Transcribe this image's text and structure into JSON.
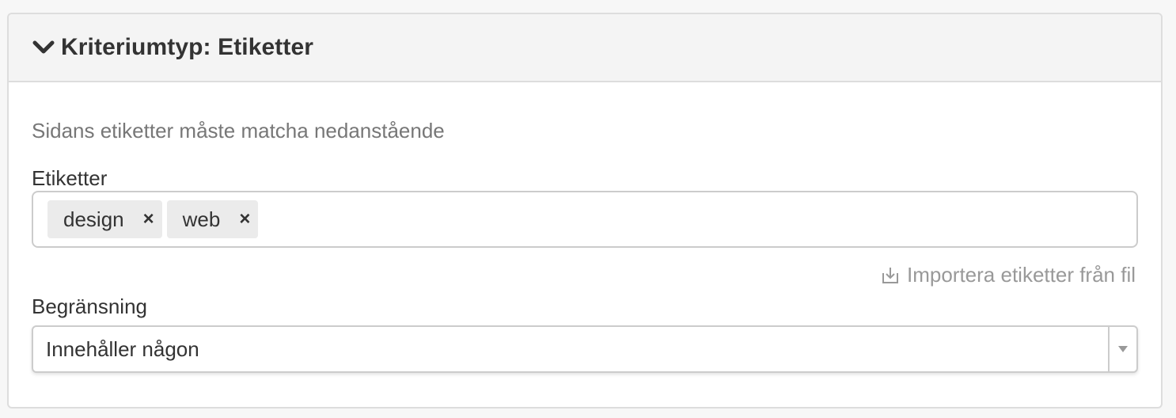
{
  "panel": {
    "title": "Kriteriumtyp: Etiketter",
    "chevron_icon": "chevron-down-icon"
  },
  "help_text": "Sidans etiketter måste matcha nedanstående",
  "tags_field": {
    "label": "Etiketter",
    "tags": [
      {
        "label": "design",
        "remove": "×"
      },
      {
        "label": "web",
        "remove": "×"
      }
    ]
  },
  "import_link": {
    "label": "Importera etiketter från fil",
    "icon": "import-icon"
  },
  "limit_field": {
    "label": "Begränsning",
    "selected": "Innehåller någon",
    "arrow_icon": "caret-down-icon"
  },
  "colors": {
    "header_bg": "#f4f4f4",
    "border": "#dddddd",
    "tag_bg": "#ebebeb",
    "muted_text": "#777777",
    "link_text": "#999999"
  }
}
